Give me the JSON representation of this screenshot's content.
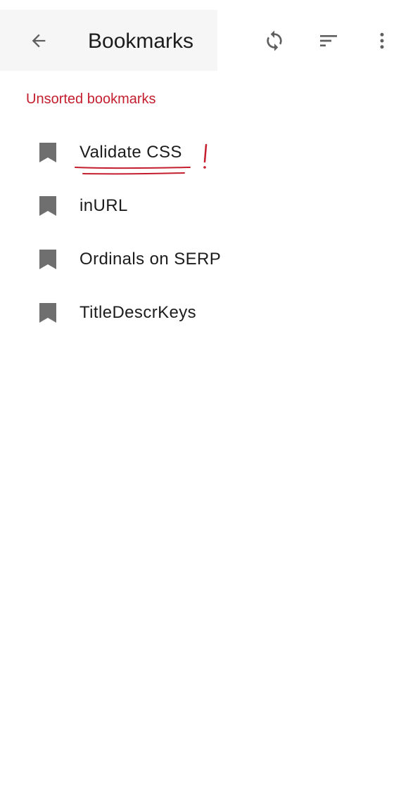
{
  "app_bar": {
    "title": "Bookmarks",
    "icons": {
      "back": "arrow-back-icon",
      "sync": "sync-icon",
      "sort": "sort-icon",
      "more": "more-vert-icon"
    }
  },
  "section": {
    "header": "Unsorted bookmarks"
  },
  "bookmarks": [
    {
      "label": "Validate CSS",
      "icon": "bookmark-icon"
    },
    {
      "label": "inURL",
      "icon": "bookmark-icon"
    },
    {
      "label": "Ordinals on SERP",
      "icon": "bookmark-icon"
    },
    {
      "label": "TitleDescrKeys",
      "icon": "bookmark-icon"
    }
  ],
  "colors": {
    "accent": "#c41e2e",
    "icon": "#6f6f6f",
    "text": "#1c1c1c",
    "title_bg": "#f6f6f6"
  }
}
